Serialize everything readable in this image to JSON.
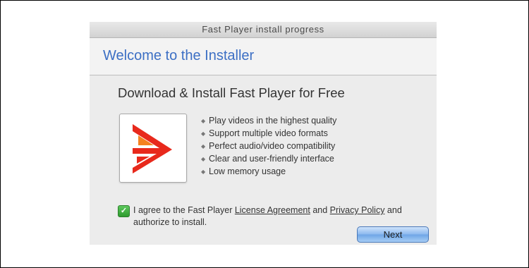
{
  "window": {
    "title": "Fast Player install progress"
  },
  "header": {
    "title": "Welcome to the Installer"
  },
  "main": {
    "heading": "Download & Install Fast Player for Free",
    "logo_icon": "fast-player-logo-icon",
    "features": [
      "Play videos in the highest quality",
      "Support multiple video formats",
      "Perfect audio/video compatibility",
      "Clear and user-friendly interface",
      "Low memory usage"
    ]
  },
  "agreement": {
    "checked": true,
    "text_before": "I agree to the Fast Player ",
    "license_link": "License Agreement",
    "text_middle": " and ",
    "privacy_link": "Privacy Policy",
    "text_after": " and authorize to install."
  },
  "buttons": {
    "next_label": "Next"
  },
  "colors": {
    "header_title": "#3c6fc4",
    "logo_red": "#e8291c",
    "logo_orange": "#f58220",
    "check_green": "#3aa83a",
    "next_button": "#7fb2ec"
  }
}
